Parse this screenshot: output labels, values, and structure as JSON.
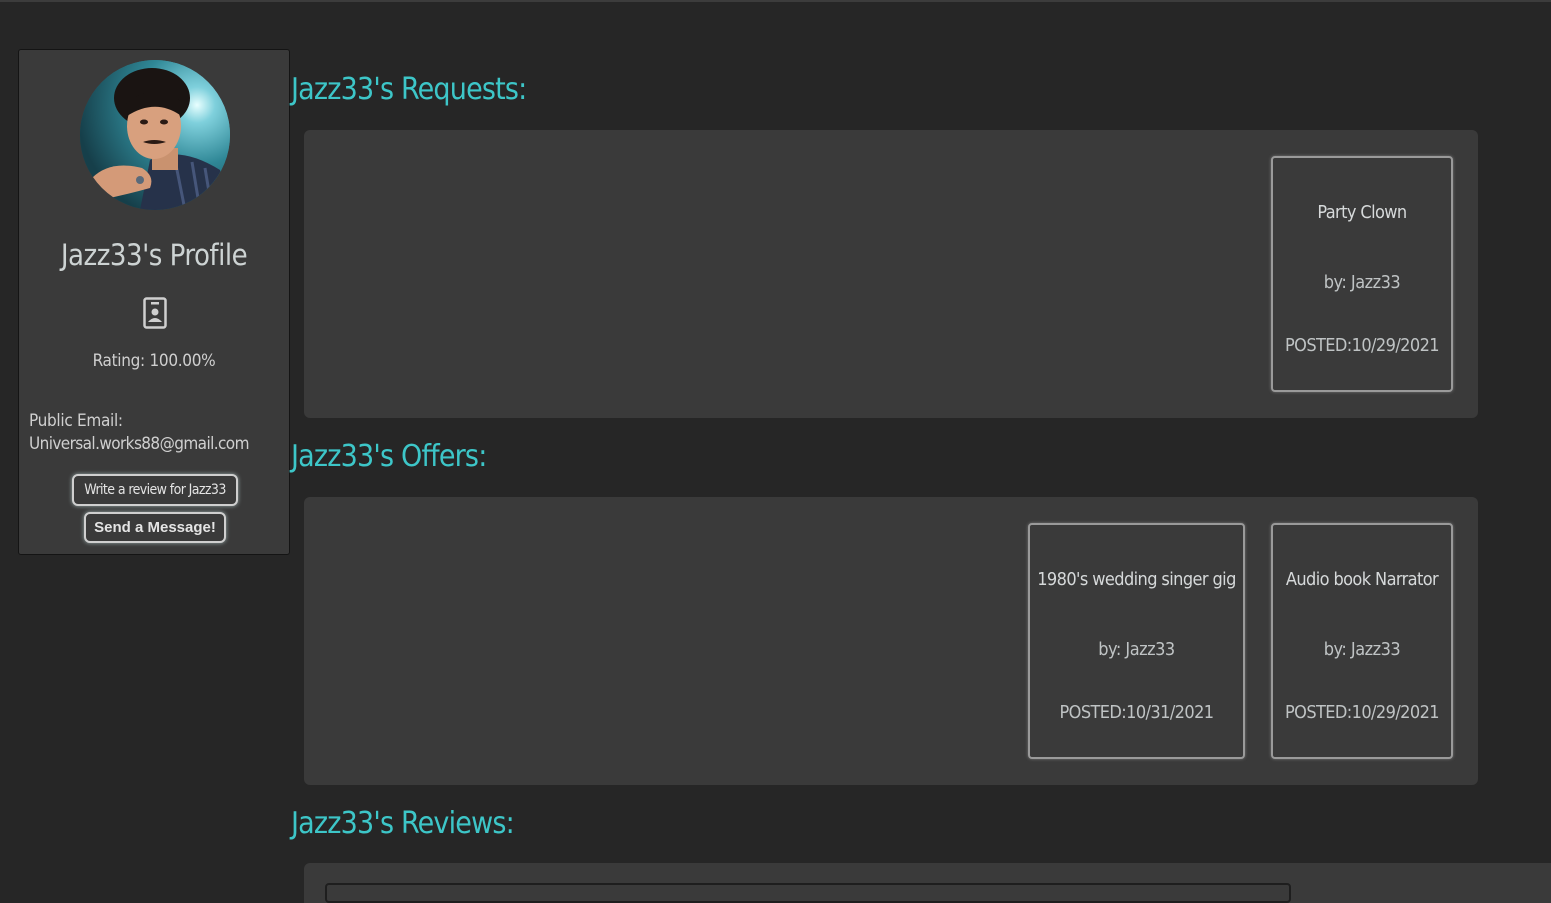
{
  "profile": {
    "title": "Jazz33's Profile",
    "rating": "Rating: 100.00%",
    "email_label": "Public Email:",
    "email": "Universal.works88@gmail.com",
    "review_button": "Write a review for Jazz33",
    "message_button": "Send a Message!",
    "icon": "contact-card-icon"
  },
  "requests": {
    "heading": "Jazz33's Requests:",
    "items": [
      {
        "title": "Party Clown",
        "by": "by: Jazz33",
        "posted": "POSTED:10/29/2021"
      }
    ]
  },
  "offers": {
    "heading": "Jazz33's Offers:",
    "items": [
      {
        "title": "1980's wedding singer gig",
        "by": "by: Jazz33",
        "posted": "POSTED:10/31/2021"
      },
      {
        "title": "Audio book Narrator",
        "by": "by: Jazz33",
        "posted": "POSTED:10/29/2021"
      }
    ]
  },
  "reviews": {
    "heading": "Jazz33's Reviews:"
  },
  "colors": {
    "background": "#262626",
    "panel": "#3a3a3a",
    "accent": "#3dc6c8"
  }
}
